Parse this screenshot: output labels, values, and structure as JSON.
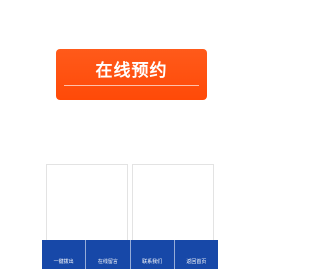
{
  "booking": {
    "label": "在线预约"
  },
  "bottom_nav": {
    "items": [
      {
        "label": "一键拨出"
      },
      {
        "label": "在线留言"
      },
      {
        "label": "联系我们"
      },
      {
        "label": "返回首页"
      }
    ]
  },
  "colors": {
    "accent_orange": "#ff4f0f",
    "nav_blue": "#1748a8"
  }
}
